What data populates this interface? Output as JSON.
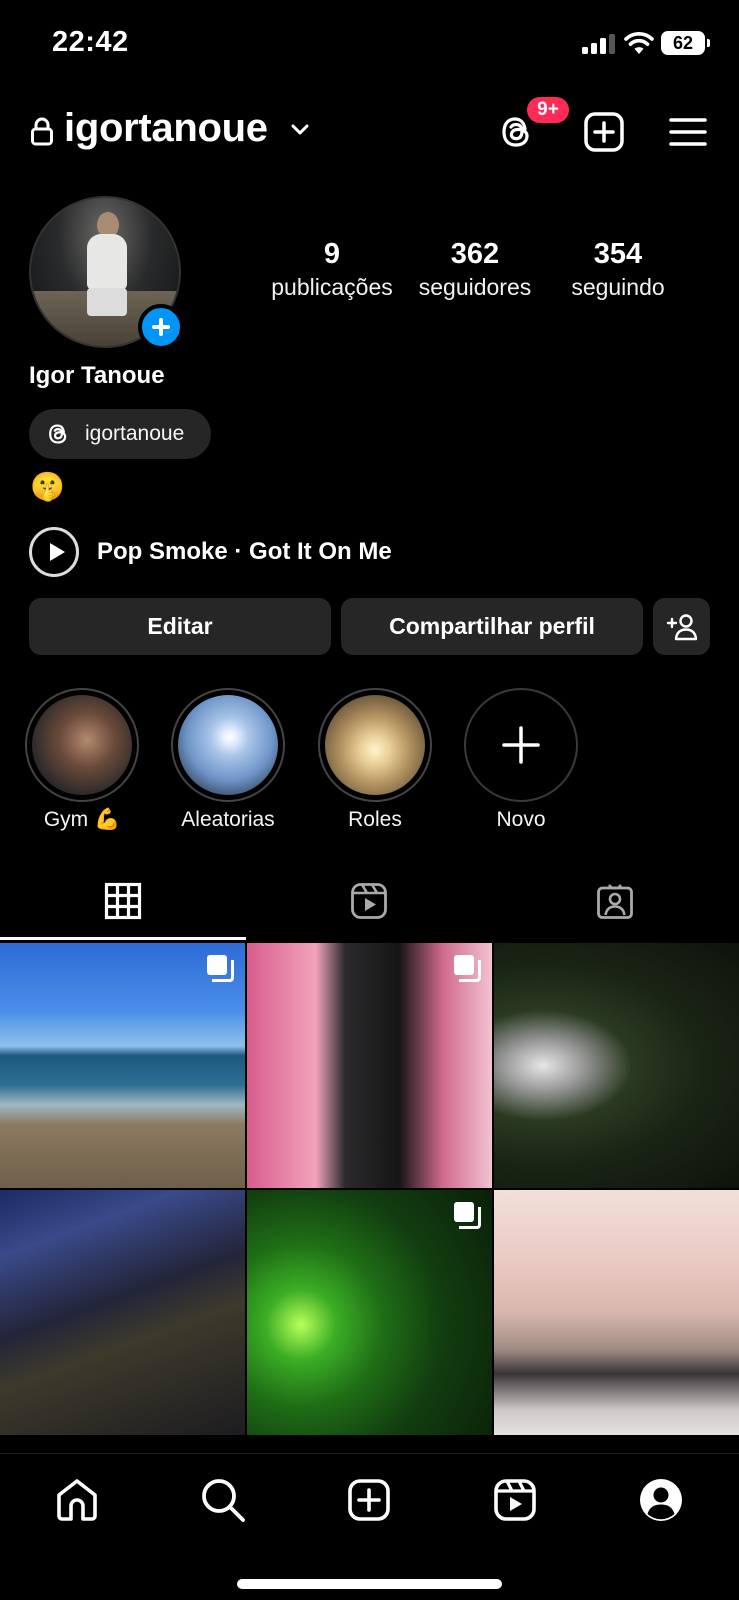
{
  "status_bar": {
    "time": "22:42",
    "battery": "62"
  },
  "header": {
    "username": "igortanoue",
    "threads_badge": "9+"
  },
  "profile": {
    "name": "Igor Tanoue",
    "threads_handle": "igortanoue",
    "bio_emoji": "🤫",
    "music": "Pop Smoke · Got It On Me",
    "stats": [
      {
        "value": "9",
        "label": "publicações"
      },
      {
        "value": "362",
        "label": "seguidores"
      },
      {
        "value": "354",
        "label": "seguindo"
      }
    ]
  },
  "actions": {
    "edit": "Editar",
    "share": "Compartilhar perfil"
  },
  "highlights": [
    {
      "label": "Gym 💪"
    },
    {
      "label": "Aleatorias"
    },
    {
      "label": "Roles"
    },
    {
      "label": "Novo"
    }
  ],
  "tabs": [
    "grid-icon",
    "reels-icon",
    "tagged-icon"
  ],
  "bottom_nav": [
    "home-icon",
    "search-icon",
    "create-icon",
    "reels-icon",
    "profile-icon"
  ],
  "colors": {
    "accent": "#0095f6",
    "badge": "#ff2a55",
    "surface": "#262626"
  }
}
